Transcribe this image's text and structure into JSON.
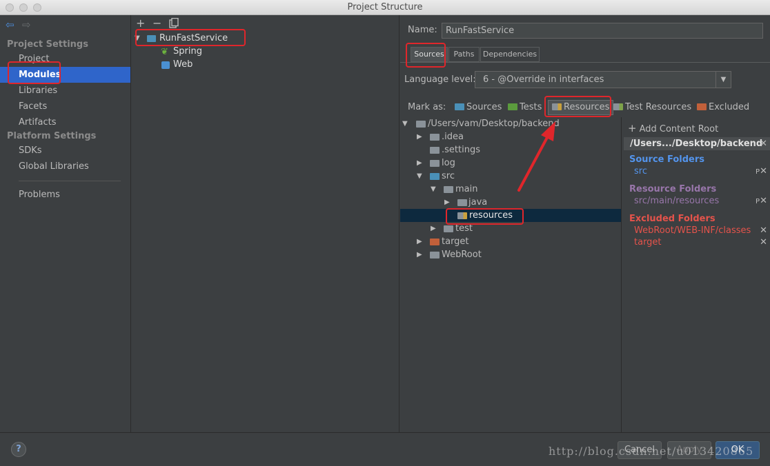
{
  "window": {
    "title": "Project Structure"
  },
  "nav": {
    "project_settings_header": "Project Settings",
    "project_settings_items": [
      "Project",
      "Modules",
      "Libraries",
      "Facets",
      "Artifacts"
    ],
    "platform_settings_header": "Platform Settings",
    "platform_settings_items": [
      "SDKs",
      "Global Libraries"
    ],
    "problems": "Problems",
    "selected": "Modules"
  },
  "module_tree": {
    "toolbar": [
      "+",
      "−"
    ],
    "root": "RunFastService",
    "children": [
      "Spring",
      "Web"
    ]
  },
  "module_detail": {
    "name_label": "Name:",
    "name_value": "RunFastService",
    "tabs": [
      "Sources",
      "Paths",
      "Dependencies"
    ],
    "active_tab": "Sources",
    "language_level_label": "Language level:",
    "language_level_value": "6 - @Override in interfaces",
    "mark_as_label": "Mark as:",
    "mark_as": [
      "Sources",
      "Tests",
      "Resources",
      "Test Resources",
      "Excluded"
    ]
  },
  "content_tree": {
    "root": "/Users/vam/Desktop/backend",
    "rows": [
      ".idea",
      ".settings",
      "log",
      "src",
      "main",
      "java",
      "resources",
      "test",
      "target",
      "WebRoot"
    ],
    "selected": "resources"
  },
  "content_roots": {
    "add_label": "Add Content Root",
    "root_path": "/Users.../Desktop/backend",
    "source_header": "Source Folders",
    "source_items": [
      "src"
    ],
    "resource_header": "Resource Folders",
    "resource_items": [
      "src/main/resources"
    ],
    "excluded_header": "Excluded Folders",
    "excluded_items": [
      "WebRoot/WEB-INF/classes",
      "target"
    ]
  },
  "buttons": {
    "help": "?",
    "cancel": "Cancel",
    "apply": "Apply",
    "ok": "OK"
  },
  "watermark": "http://blog.csdn.net/u013420865",
  "colors": {
    "selection": "#2f65ca",
    "source_header": "#5394ec",
    "resource_header": "#9876aa",
    "excluded_header": "#e5534b",
    "annotation": "#e0262b"
  }
}
